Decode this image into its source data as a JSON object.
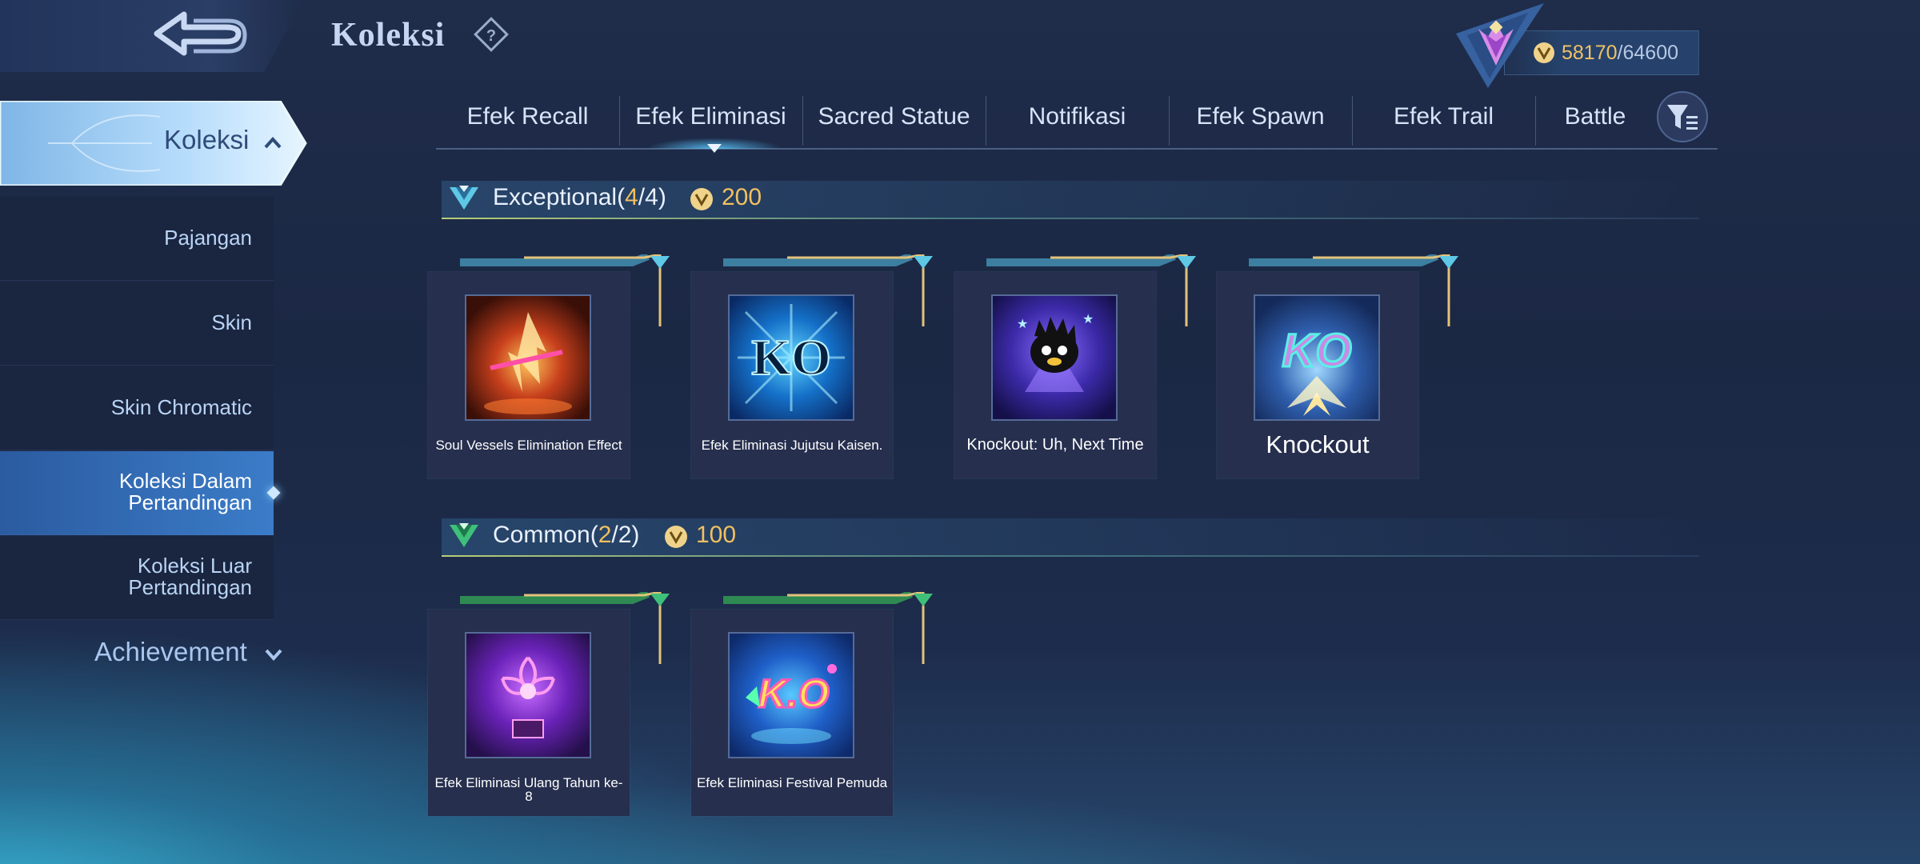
{
  "header": {
    "title": "Koleksi",
    "currency_current": "58170",
    "currency_separator": "/",
    "currency_max": "64600"
  },
  "sidebar": {
    "active_group": "Koleksi",
    "items": [
      {
        "label": "Pajangan",
        "active": false
      },
      {
        "label": "Skin",
        "active": false
      },
      {
        "label": "Skin Chromatic",
        "active": false
      },
      {
        "label": "Koleksi Dalam Pertandingan",
        "active": true
      },
      {
        "label": "Koleksi Luar Pertandingan",
        "active": false
      }
    ],
    "achievement_label": "Achievement"
  },
  "tabs": [
    {
      "label": "Efek Recall",
      "active": false
    },
    {
      "label": "Efek Eliminasi",
      "active": true
    },
    {
      "label": "Sacred Statue",
      "active": false
    },
    {
      "label": "Notifikasi",
      "active": false
    },
    {
      "label": "Efek Spawn",
      "active": false
    },
    {
      "label": "Efek Trail",
      "active": false
    },
    {
      "label": "Battle",
      "active": false
    }
  ],
  "sections": [
    {
      "name": "Exceptional",
      "count_open": "(",
      "owned": "4",
      "slash": "/",
      "total": "4",
      "count_close": ")",
      "price": "200",
      "accent": "#5ec8e6",
      "items": [
        {
          "label": "Soul Vessels Elimination Effect",
          "icon": "soul-vessels-flame-icon"
        },
        {
          "label": "Efek Eliminasi Jujutsu Kaisen.",
          "icon": "jujutsu-kaisen-ko-icon"
        },
        {
          "label": "Knockout: Uh, Next Time",
          "icon": "badtz-maru-icon"
        },
        {
          "label": "Knockout",
          "icon": "knockout-ko-icon"
        }
      ]
    },
    {
      "name": "Common",
      "count_open": "(",
      "owned": "2",
      "slash": "/",
      "total": "2",
      "count_close": ")",
      "price": "100",
      "accent": "#3fc07a",
      "items": [
        {
          "label": "Efek Eliminasi Ulang Tahun ke-8",
          "icon": "anniversary-flower-icon"
        },
        {
          "label": "Efek Eliminasi Festival Pemuda",
          "icon": "festival-ko-icon"
        }
      ]
    }
  ],
  "colors": {
    "background": "#1d2b4a",
    "gold": "#f2c060",
    "active_blue": "#3b7cc8"
  }
}
